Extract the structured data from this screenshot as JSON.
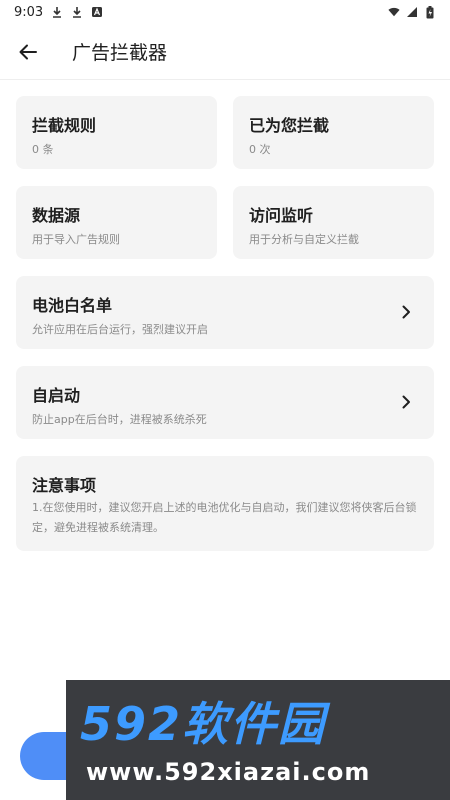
{
  "status_bar": {
    "time": "9:03",
    "left_icons": [
      "download-icon",
      "download-icon",
      "notification-a-icon"
    ],
    "right_icons": [
      "wifi-icon",
      "signal-icon",
      "battery-icon"
    ]
  },
  "app_bar": {
    "title": "广告拦截器"
  },
  "cards": {
    "rules": {
      "title": "拦截规则",
      "subtitle": "0 条"
    },
    "blocked": {
      "title": "已为您拦截",
      "subtitle": "0 次"
    },
    "data_source": {
      "title": "数据源",
      "subtitle": "用于导入广告规则"
    },
    "monitor": {
      "title": "访问监听",
      "subtitle": "用于分析与自定义拦截"
    },
    "battery_whitelist": {
      "title": "电池白名单",
      "subtitle": "允许应用在后台运行，强烈建议开启"
    },
    "autostart": {
      "title": "自启动",
      "subtitle": "防止app在后台时，进程被系统杀死"
    },
    "notice": {
      "title": "注意事项",
      "body": "1.在您使用时，建议您开启上述的电池优化与自启动，我们建议您将侠客后台锁定，避免进程被系统清理。"
    }
  },
  "watermark": {
    "brand": "592软件园",
    "url": "www.592xiazai.com"
  },
  "colors": {
    "card_bg": "#f4f4f4",
    "accent": "#4f8ef7",
    "watermark_bg": "#3a3c40",
    "watermark_brand": "#3d9bff"
  }
}
